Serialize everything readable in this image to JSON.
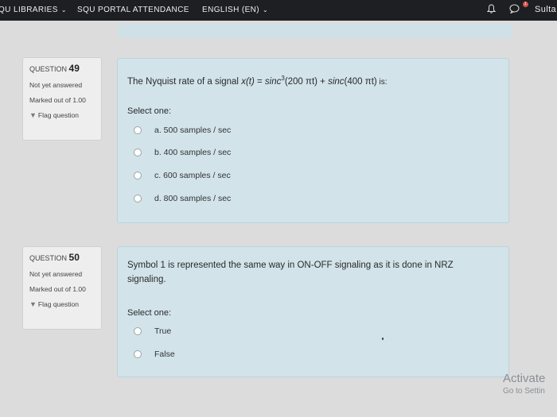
{
  "navbar": {
    "items": [
      {
        "label": "QU LIBRARIES",
        "chevron": "⌄"
      },
      {
        "label": "SQU PORTAL ATTENDANCE"
      },
      {
        "label": "ENGLISH (EN)",
        "chevron": "⌄"
      }
    ],
    "bell_icon": "bell-icon",
    "chat_icon": "chat-icon",
    "notification_count": "1",
    "user_name": "Sulta"
  },
  "questions": [
    {
      "number_label": "QUESTION",
      "number": "49",
      "status": "Not yet answered",
      "marks": "Marked out of 1.00",
      "flag_label": "Flag question",
      "text_prefix": "The Nyquist rate of a signal ",
      "formula_parts": [
        "x(t)",
        " = ",
        "sinc",
        "3",
        "(200 πt)",
        " + ",
        "sinc",
        "(400 πt)"
      ],
      "text_suffix": " is:",
      "select_label": "Select one:",
      "options": [
        {
          "label": "a. 500 samples / sec"
        },
        {
          "label": "b. 400 samples / sec"
        },
        {
          "label": "c. 600 samples / sec"
        },
        {
          "label": "d. 800 samples / sec"
        }
      ]
    },
    {
      "number_label": "QUESTION",
      "number": "50",
      "status": "Not yet answered",
      "marks": "Marked out of 1.00",
      "flag_label": "Flag question",
      "text_line1": "Symbol 1 is represented the same way in ON-OFF signaling as it is done in NRZ",
      "text_line2": "signaling.",
      "select_label": "Select one:",
      "options": [
        {
          "label": "True"
        },
        {
          "label": "False"
        }
      ]
    }
  ],
  "watermark": {
    "line1": "Activate",
    "line2": "Go to Settin"
  }
}
